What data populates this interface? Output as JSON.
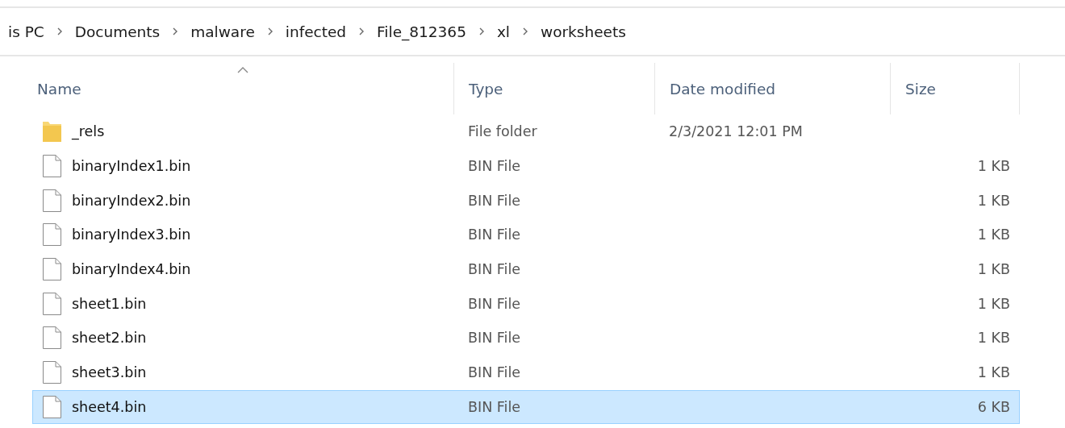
{
  "breadcrumb": [
    "is PC",
    "Documents",
    "malware",
    "infected",
    "File_812365",
    "xl",
    "worksheets"
  ],
  "columns": [
    {
      "label": "Name",
      "sorted": true
    },
    {
      "label": "Type",
      "sorted": false
    },
    {
      "label": "Date modified",
      "sorted": false
    },
    {
      "label": "Size",
      "sorted": false
    }
  ],
  "rows": [
    {
      "kind": "folder",
      "name": "_rels",
      "type": "File folder",
      "date": "2/3/2021 12:01 PM",
      "selected": false
    },
    {
      "kind": "file",
      "name": "binaryIndex1.bin",
      "type": "BIN File",
      "size": "1 KB",
      "selected": false
    },
    {
      "kind": "file",
      "name": "binaryIndex2.bin",
      "type": "BIN File",
      "size": "1 KB",
      "selected": false
    },
    {
      "kind": "file",
      "name": "binaryIndex3.bin",
      "type": "BIN File",
      "size": "1 KB",
      "selected": false
    },
    {
      "kind": "file",
      "name": "binaryIndex4.bin",
      "type": "BIN File",
      "size": "1 KB",
      "selected": false
    },
    {
      "kind": "file",
      "name": "sheet1.bin",
      "type": "BIN File",
      "size": "1 KB",
      "selected": false
    },
    {
      "kind": "file",
      "name": "sheet2.bin",
      "type": "BIN File",
      "size": "1 KB",
      "selected": false
    },
    {
      "kind": "file",
      "name": "sheet3.bin",
      "type": "BIN File",
      "size": "1 KB",
      "selected": false
    },
    {
      "kind": "file",
      "name": "sheet4.bin",
      "type": "BIN File",
      "size": "6 KB",
      "selected": true
    }
  ]
}
